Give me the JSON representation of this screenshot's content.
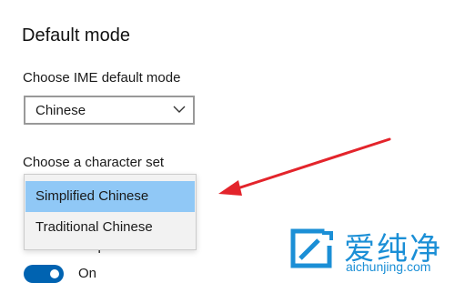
{
  "section": {
    "title": "Default mode"
  },
  "ime": {
    "label": "Choose IME default mode",
    "selected": "Chinese"
  },
  "charset": {
    "label": "Choose a character set",
    "options": [
      "Simplified Chinese",
      "Traditional Chinese"
    ],
    "highlighted_index": 0
  },
  "half_width": {
    "label": "Half-width input mode",
    "toggle_state": "On",
    "toggle_on": true
  },
  "annotation": {
    "arrow_color": "#e3242b"
  },
  "watermark": {
    "chinese": "爱纯净",
    "domain": "aichunjing.com",
    "color": "#1b8fd6"
  },
  "colors": {
    "accent": "#0063b1",
    "highlight": "#90c8f6"
  }
}
